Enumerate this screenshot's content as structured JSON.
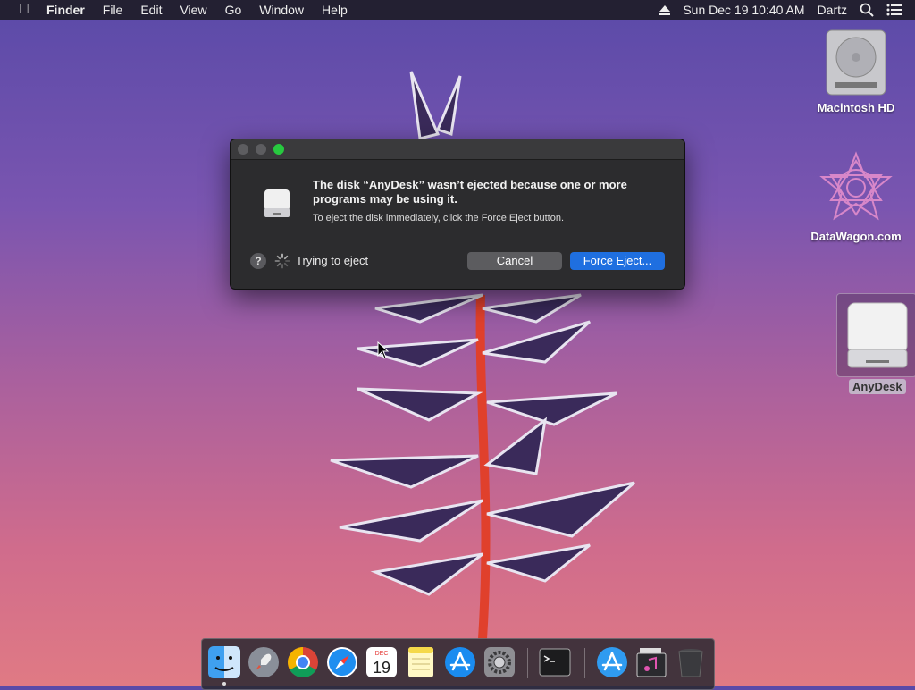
{
  "menubar": {
    "apple": "",
    "app_name": "Finder",
    "menus": [
      "File",
      "Edit",
      "View",
      "Go",
      "Window",
      "Help"
    ],
    "datetime": "Sun Dec 19  10:40 AM",
    "user": "Dartz"
  },
  "desktop": {
    "icons": [
      {
        "label": "Macintosh HD"
      },
      {
        "label": "DataWagon.com"
      },
      {
        "label": "AnyDesk"
      }
    ]
  },
  "dialog": {
    "title": "The disk “AnyDesk” wasn’t ejected because one or more programs may be using it.",
    "message": "To eject the disk immediately, click the Force Eject button.",
    "help": "?",
    "status": "Trying to eject",
    "cancel_label": "Cancel",
    "force_label": "Force Eject..."
  },
  "dock": {
    "calendar_month": "DEC",
    "calendar_day": "19"
  }
}
